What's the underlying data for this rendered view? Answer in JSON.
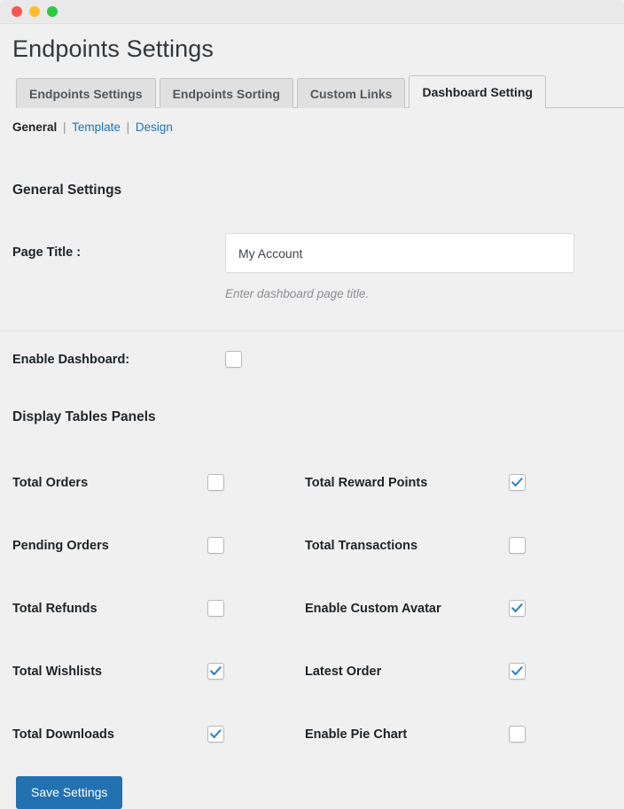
{
  "window": {
    "controls": [
      {
        "name": "close",
        "color": "#f9574f"
      },
      {
        "name": "minimize",
        "color": "#fbbd2e"
      },
      {
        "name": "maximize",
        "color": "#2cc940"
      }
    ]
  },
  "header": {
    "title": "Endpoints Settings"
  },
  "tabs": [
    {
      "label": "Endpoints Settings",
      "active": false
    },
    {
      "label": "Endpoints Sorting",
      "active": false
    },
    {
      "label": "Custom Links",
      "active": false
    },
    {
      "label": "Dashboard Setting",
      "active": true
    }
  ],
  "subnav": {
    "items": [
      {
        "label": "General",
        "active": true
      },
      {
        "label": "Template",
        "active": false
      },
      {
        "label": "Design",
        "active": false
      }
    ],
    "separator": "|"
  },
  "general": {
    "heading": "General Settings",
    "page_title": {
      "label": "Page Title :",
      "value": "My Account",
      "placeholder": "My Account",
      "help": "Enter dashboard page title."
    },
    "enable_dashboard": {
      "label": "Enable Dashboard:",
      "checked": false
    }
  },
  "panels": {
    "heading": "Display Tables Panels",
    "rows": [
      {
        "left": {
          "label": "Total Orders",
          "checked": false
        },
        "right": {
          "label": "Total Reward Points",
          "checked": true
        }
      },
      {
        "left": {
          "label": "Pending Orders",
          "checked": false
        },
        "right": {
          "label": "Total Transactions",
          "checked": false
        }
      },
      {
        "left": {
          "label": "Total Refunds",
          "checked": false
        },
        "right": {
          "label": "Enable Custom Avatar",
          "checked": true
        }
      },
      {
        "left": {
          "label": "Total Wishlists",
          "checked": true
        },
        "right": {
          "label": "Latest Order",
          "checked": true
        }
      },
      {
        "left": {
          "label": "Total Downloads",
          "checked": true
        },
        "right": {
          "label": "Enable Pie Chart",
          "checked": false
        }
      }
    ]
  },
  "footer": {
    "save_label": "Save Settings"
  },
  "colors": {
    "accent": "#2271b1",
    "page_background": "#f0f0f0",
    "tab_inactive": "#e0e0e0",
    "checkbox_tick": "#3582c4",
    "link": "#2271b1"
  }
}
